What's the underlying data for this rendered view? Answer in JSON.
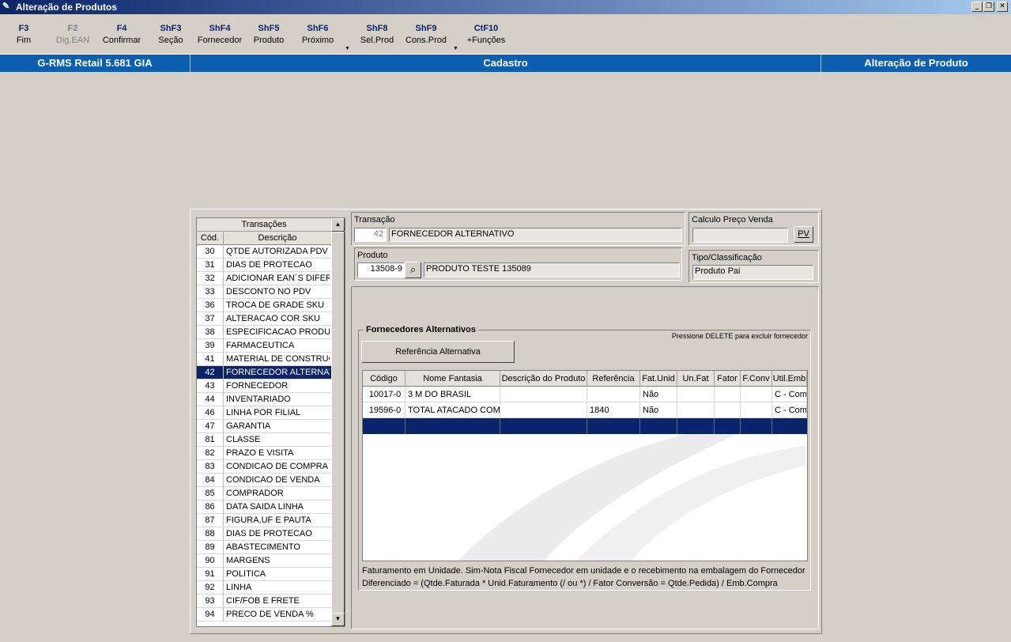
{
  "window": {
    "title": "Alteração de Produtos"
  },
  "toolbar": [
    {
      "key": "F3",
      "label": "Fim",
      "enabled": true
    },
    {
      "key": "F2",
      "label": "Dig.EAN",
      "enabled": false
    },
    {
      "key": "F4",
      "label": "Confirmar",
      "enabled": true
    },
    {
      "key": "ShF3",
      "label": "Seção",
      "enabled": true
    },
    {
      "key": "ShF4",
      "label": "Fornecedor",
      "enabled": true
    },
    {
      "key": "ShF5",
      "label": "Produto",
      "enabled": true
    },
    {
      "key": "ShF6",
      "label": "Próximo",
      "enabled": true
    },
    {
      "key": "ShF8",
      "label": "Sel.Prod",
      "enabled": true
    },
    {
      "key": "ShF9",
      "label": "Cons.Prod",
      "enabled": true
    },
    {
      "key": "CtF10",
      "label": "+Funções",
      "enabled": true
    }
  ],
  "statusbar": {
    "app": "G-RMS Retail 5.681 GIA",
    "module": "Cadastro",
    "screen": "Alteração de Produto"
  },
  "transactions": {
    "title": "Transações",
    "col_code": "Cód.",
    "col_desc": "Descrição",
    "selected_code": "42",
    "items": [
      {
        "code": "30",
        "desc": "QTDE AUTORIZADA PDV"
      },
      {
        "code": "31",
        "desc": "DIAS DE PROTECAO"
      },
      {
        "code": "32",
        "desc": "ADICIONAR EAN´S DIFERENTES"
      },
      {
        "code": "33",
        "desc": "DESCONTO NO PDV"
      },
      {
        "code": "36",
        "desc": "TROCA DE GRADE SKU"
      },
      {
        "code": "37",
        "desc": "ALTERACAO COR SKU"
      },
      {
        "code": "38",
        "desc": "ESPECIFICACAO PRODUTO"
      },
      {
        "code": "39",
        "desc": "FARMACEUTICA"
      },
      {
        "code": "41",
        "desc": "MATERIAL DE CONSTRUCAO"
      },
      {
        "code": "42",
        "desc": "FORNECEDOR ALTERNATIVO"
      },
      {
        "code": "43",
        "desc": "FORNECEDOR"
      },
      {
        "code": "44",
        "desc": "INVENTARIADO"
      },
      {
        "code": "46",
        "desc": "LINHA POR FILIAL"
      },
      {
        "code": "47",
        "desc": "GARANTIA"
      },
      {
        "code": "81",
        "desc": "CLASSE"
      },
      {
        "code": "82",
        "desc": "PRAZO E VISITA"
      },
      {
        "code": "83",
        "desc": "CONDICAO DE COMPRA"
      },
      {
        "code": "84",
        "desc": "CONDICAO DE VENDA"
      },
      {
        "code": "85",
        "desc": "COMPRADOR"
      },
      {
        "code": "86",
        "desc": "DATA SAIDA LINHA"
      },
      {
        "code": "87",
        "desc": "FIGURA,UF E PAUTA"
      },
      {
        "code": "88",
        "desc": "DIAS DE PROTECAO"
      },
      {
        "code": "89",
        "desc": "ABASTECIMENTO"
      },
      {
        "code": "90",
        "desc": "MARGENS"
      },
      {
        "code": "91",
        "desc": "POLITICA"
      },
      {
        "code": "92",
        "desc": "LINHA"
      },
      {
        "code": "93",
        "desc": "CIF/FOB E FRETE"
      },
      {
        "code": "94",
        "desc": "PRECO DE VENDA %"
      }
    ]
  },
  "transacao": {
    "label": "Transação",
    "code": "42",
    "desc": "FORNECEDOR ALTERNATIVO"
  },
  "produto": {
    "label": "Produto",
    "code": "13508-9",
    "desc": "PRODUTO TESTE 135089"
  },
  "calculo": {
    "label": "Calculo Preço Venda",
    "value": "",
    "button": "PV"
  },
  "tipo": {
    "label": "Tipo/Classificação",
    "value": "Produto Pai"
  },
  "fornecedores": {
    "title": "Fornecedores Alternativos",
    "hint": "Pressione DELETE para excluir fornecedor",
    "ref_button": "Referência Alternativa",
    "columns": [
      "Código",
      "Nome Fantasia",
      "Descrição do Produto",
      "Referência",
      "Fat.Unid",
      "Un.Fat",
      "Fator",
      "F.Conv",
      "Util.Emb"
    ],
    "rows": [
      [
        "10017-0",
        "3 M DO BRASIL",
        "",
        "",
        "Não",
        "",
        "",
        "",
        "C - Com"
      ],
      [
        "19596-0",
        "TOTAL ATACADO COM.",
        "",
        "1840",
        "Não",
        "",
        "",
        "",
        "C - Com"
      ]
    ],
    "note1": "Faturamento em Unidade. Sim-Nota Fiscal Fornecedor em unidade e o recebimento na embalagem do Fornecedor",
    "note2": "Diferenciado = (Qtde.Faturada * Unid.Faturamento (/ ou *) / Fator Conversão  = Qtde.Pedida) / Emb.Compra"
  }
}
